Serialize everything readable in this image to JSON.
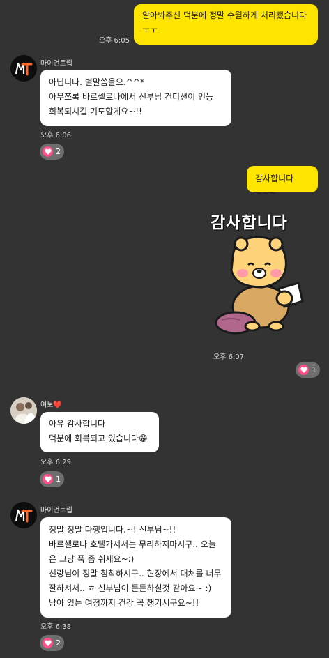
{
  "messages": [
    {
      "from": "me",
      "lines": [
        "알아봐주신 덕분에 정말 수월하게 처리됐습니다",
        "ㅜㅜ"
      ],
      "time": "오후 6:05"
    },
    {
      "from": "마이언트립",
      "lines": [
        "아닙니다. 별말씀을요.^^*",
        "아무쪼록 바르셀로나에서 신부님 컨디션이 언능",
        "회복되시길 기도할게요~!!"
      ],
      "time": "오후 6:06",
      "reaction": {
        "icon": "heart-icon",
        "count": "2"
      }
    },
    {
      "from": "me",
      "lines": [
        "감사합니다~~~"
      ]
    },
    {
      "from": "me",
      "sticker": {
        "caption": "감사합니다",
        "icon": "bear-sticker"
      },
      "time": "오후 6:07",
      "reaction": {
        "icon": "heart-icon",
        "count": "1"
      }
    },
    {
      "from": "여보",
      "from_emoji": "❤️",
      "lines": [
        "아유 감사합니다",
        "덕분에 회복되고 있습니다😁"
      ],
      "time": "오후 6:29",
      "reaction": {
        "icon": "heart-icon",
        "count": "1"
      }
    },
    {
      "from": "마이언트립",
      "lines": [
        "정말 정말 다행입니다.~! 신부님~!!",
        "바르셀로나 호텔가셔서는 무리하지마시구.. 오늘",
        "은 그냥 푹 좀 쉬세요~:)",
        "신랑님이 정말 침착하시구.. 현장에서 대처를 너무",
        "잘하셔서.. ㅎ 신부님이 든든하실것 같아요~ :)",
        "남아 있는 여정까지 건강 꼭 챙기시구요~!!"
      ],
      "time": "오후 6:38",
      "reaction": {
        "icon": "heart-icon",
        "count": "2"
      }
    }
  ],
  "colors": {
    "background": "#333333",
    "my_bubble": "#fee500",
    "other_bubble": "#ffffff",
    "heart": "#ff4f86",
    "reaction_pill": "#6e6e6e"
  }
}
